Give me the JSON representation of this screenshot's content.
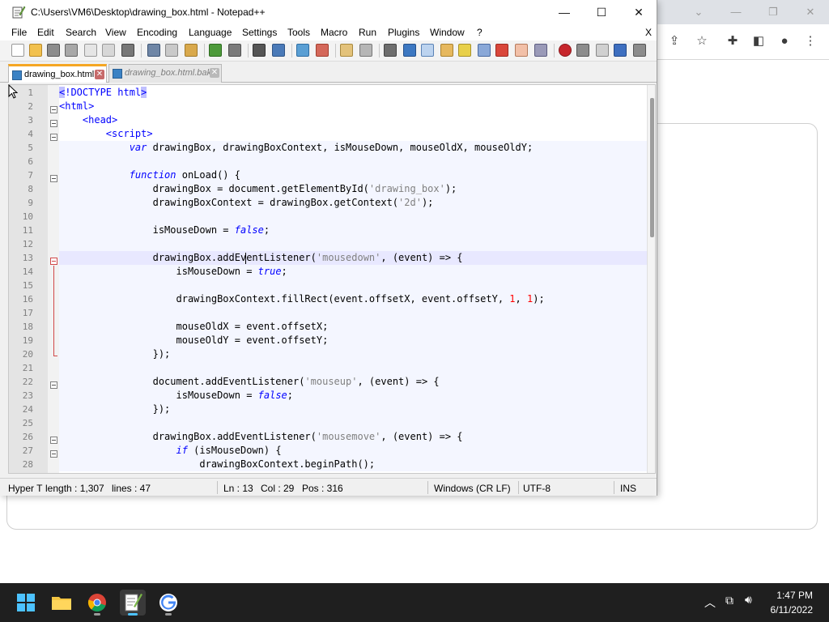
{
  "notepad": {
    "title": "C:\\Users\\VM6\\Desktop\\drawing_box.html - Notepad++",
    "window_controls": {
      "minimize": "—",
      "maximize": "☐",
      "close": "✕"
    },
    "menu": [
      "File",
      "Edit",
      "Search",
      "View",
      "Encoding",
      "Language",
      "Settings",
      "Tools",
      "Macro",
      "Run",
      "Plugins",
      "Window",
      "?"
    ],
    "menu_close": "X",
    "tabs": [
      {
        "label": "drawing_box.html",
        "active": true
      },
      {
        "label": "drawing_box.html.bak",
        "active": false
      }
    ],
    "tab_close": "✕",
    "editor": {
      "line_numbers": [
        "1",
        "2",
        "3",
        "4",
        "5",
        "6",
        "7",
        "8",
        "9",
        "10",
        "11",
        "12",
        "13",
        "14",
        "15",
        "16",
        "17",
        "18",
        "19",
        "20",
        "21",
        "22",
        "23",
        "24",
        "25",
        "26",
        "27",
        "28"
      ]
    },
    "status": {
      "lang": "Hyper T",
      "length": "length : 1,307",
      "lines": "lines : 47",
      "ln": "Ln : 13",
      "col": "Col : 29",
      "pos": "Pos : 316",
      "eol": "Windows (CR LF)",
      "encoding": "UTF-8",
      "mode": "INS"
    }
  },
  "taskbar": {
    "time": "1:47 PM",
    "date": "6/11/2022",
    "tray_icons": [
      "chevron-up-icon",
      "network-icon",
      "volume-icon"
    ]
  },
  "colors": {
    "keyword": "#0000ff",
    "string": "#808080",
    "number": "#ff0000",
    "current_line": "#e8e8ff",
    "tab_accent": "#f5a623"
  }
}
